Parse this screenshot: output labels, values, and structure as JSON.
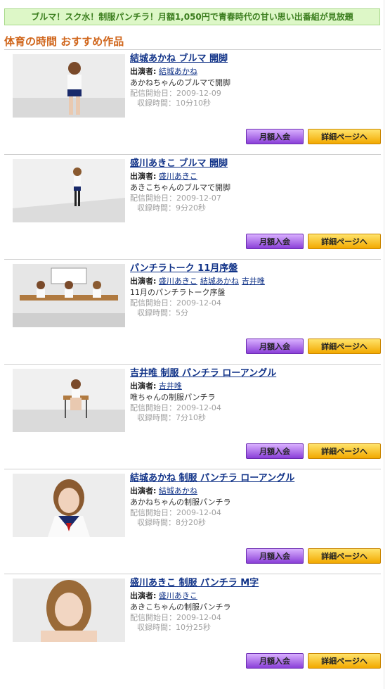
{
  "banner": {
    "text": "ブルマ！スク水！制服パンチラ！月額1,050円で青春時代の甘い思い出番組が見放題"
  },
  "section": {
    "title": "体育の時間 おすすめ作品"
  },
  "labels": {
    "cast": "出演者:",
    "join": "月額入会",
    "detail": "詳細ページへ"
  },
  "items": [
    {
      "title": "結城あかね ブルマ 開脚",
      "cast": [
        "結城あかね"
      ],
      "desc": "あかねちゃんのブルマで開脚",
      "start": "配信開始日：2009-12-09",
      "duration": "収録時間：10分10秒"
    },
    {
      "title": "盛川あきこ ブルマ 開脚",
      "cast": [
        "盛川あきこ"
      ],
      "desc": "あきこちゃんのブルマで開脚",
      "start": "配信開始日：2009-12-07",
      "duration": "収録時間：9分20秒"
    },
    {
      "title": "パンチラトーク 11月序盤",
      "cast": [
        "盛川あきこ",
        "結城あかね",
        "吉井唯"
      ],
      "desc": "11月のパンチラトーク序盤",
      "start": "配信開始日：2009-12-04",
      "duration": "収録時間：5分"
    },
    {
      "title": "吉井唯 制服 パンチラ ローアングル",
      "cast": [
        "吉井唯"
      ],
      "desc": "唯ちゃんの制服パンチラ",
      "start": "配信開始日：2009-12-04",
      "duration": "収録時間：7分10秒"
    },
    {
      "title": "結城あかね 制服 パンチラ ローアングル",
      "cast": [
        "結城あかね"
      ],
      "desc": "あかねちゃんの制服パンチラ",
      "start": "配信開始日：2009-12-04",
      "duration": "収録時間：8分20秒"
    },
    {
      "title": "盛川あきこ 制服 パンチラ M字",
      "cast": [
        "盛川あきこ"
      ],
      "desc": "あきこちゃんの制服パンチラ",
      "start": "配信開始日：2009-12-04",
      "duration": "収録時間：10分25秒"
    }
  ]
}
